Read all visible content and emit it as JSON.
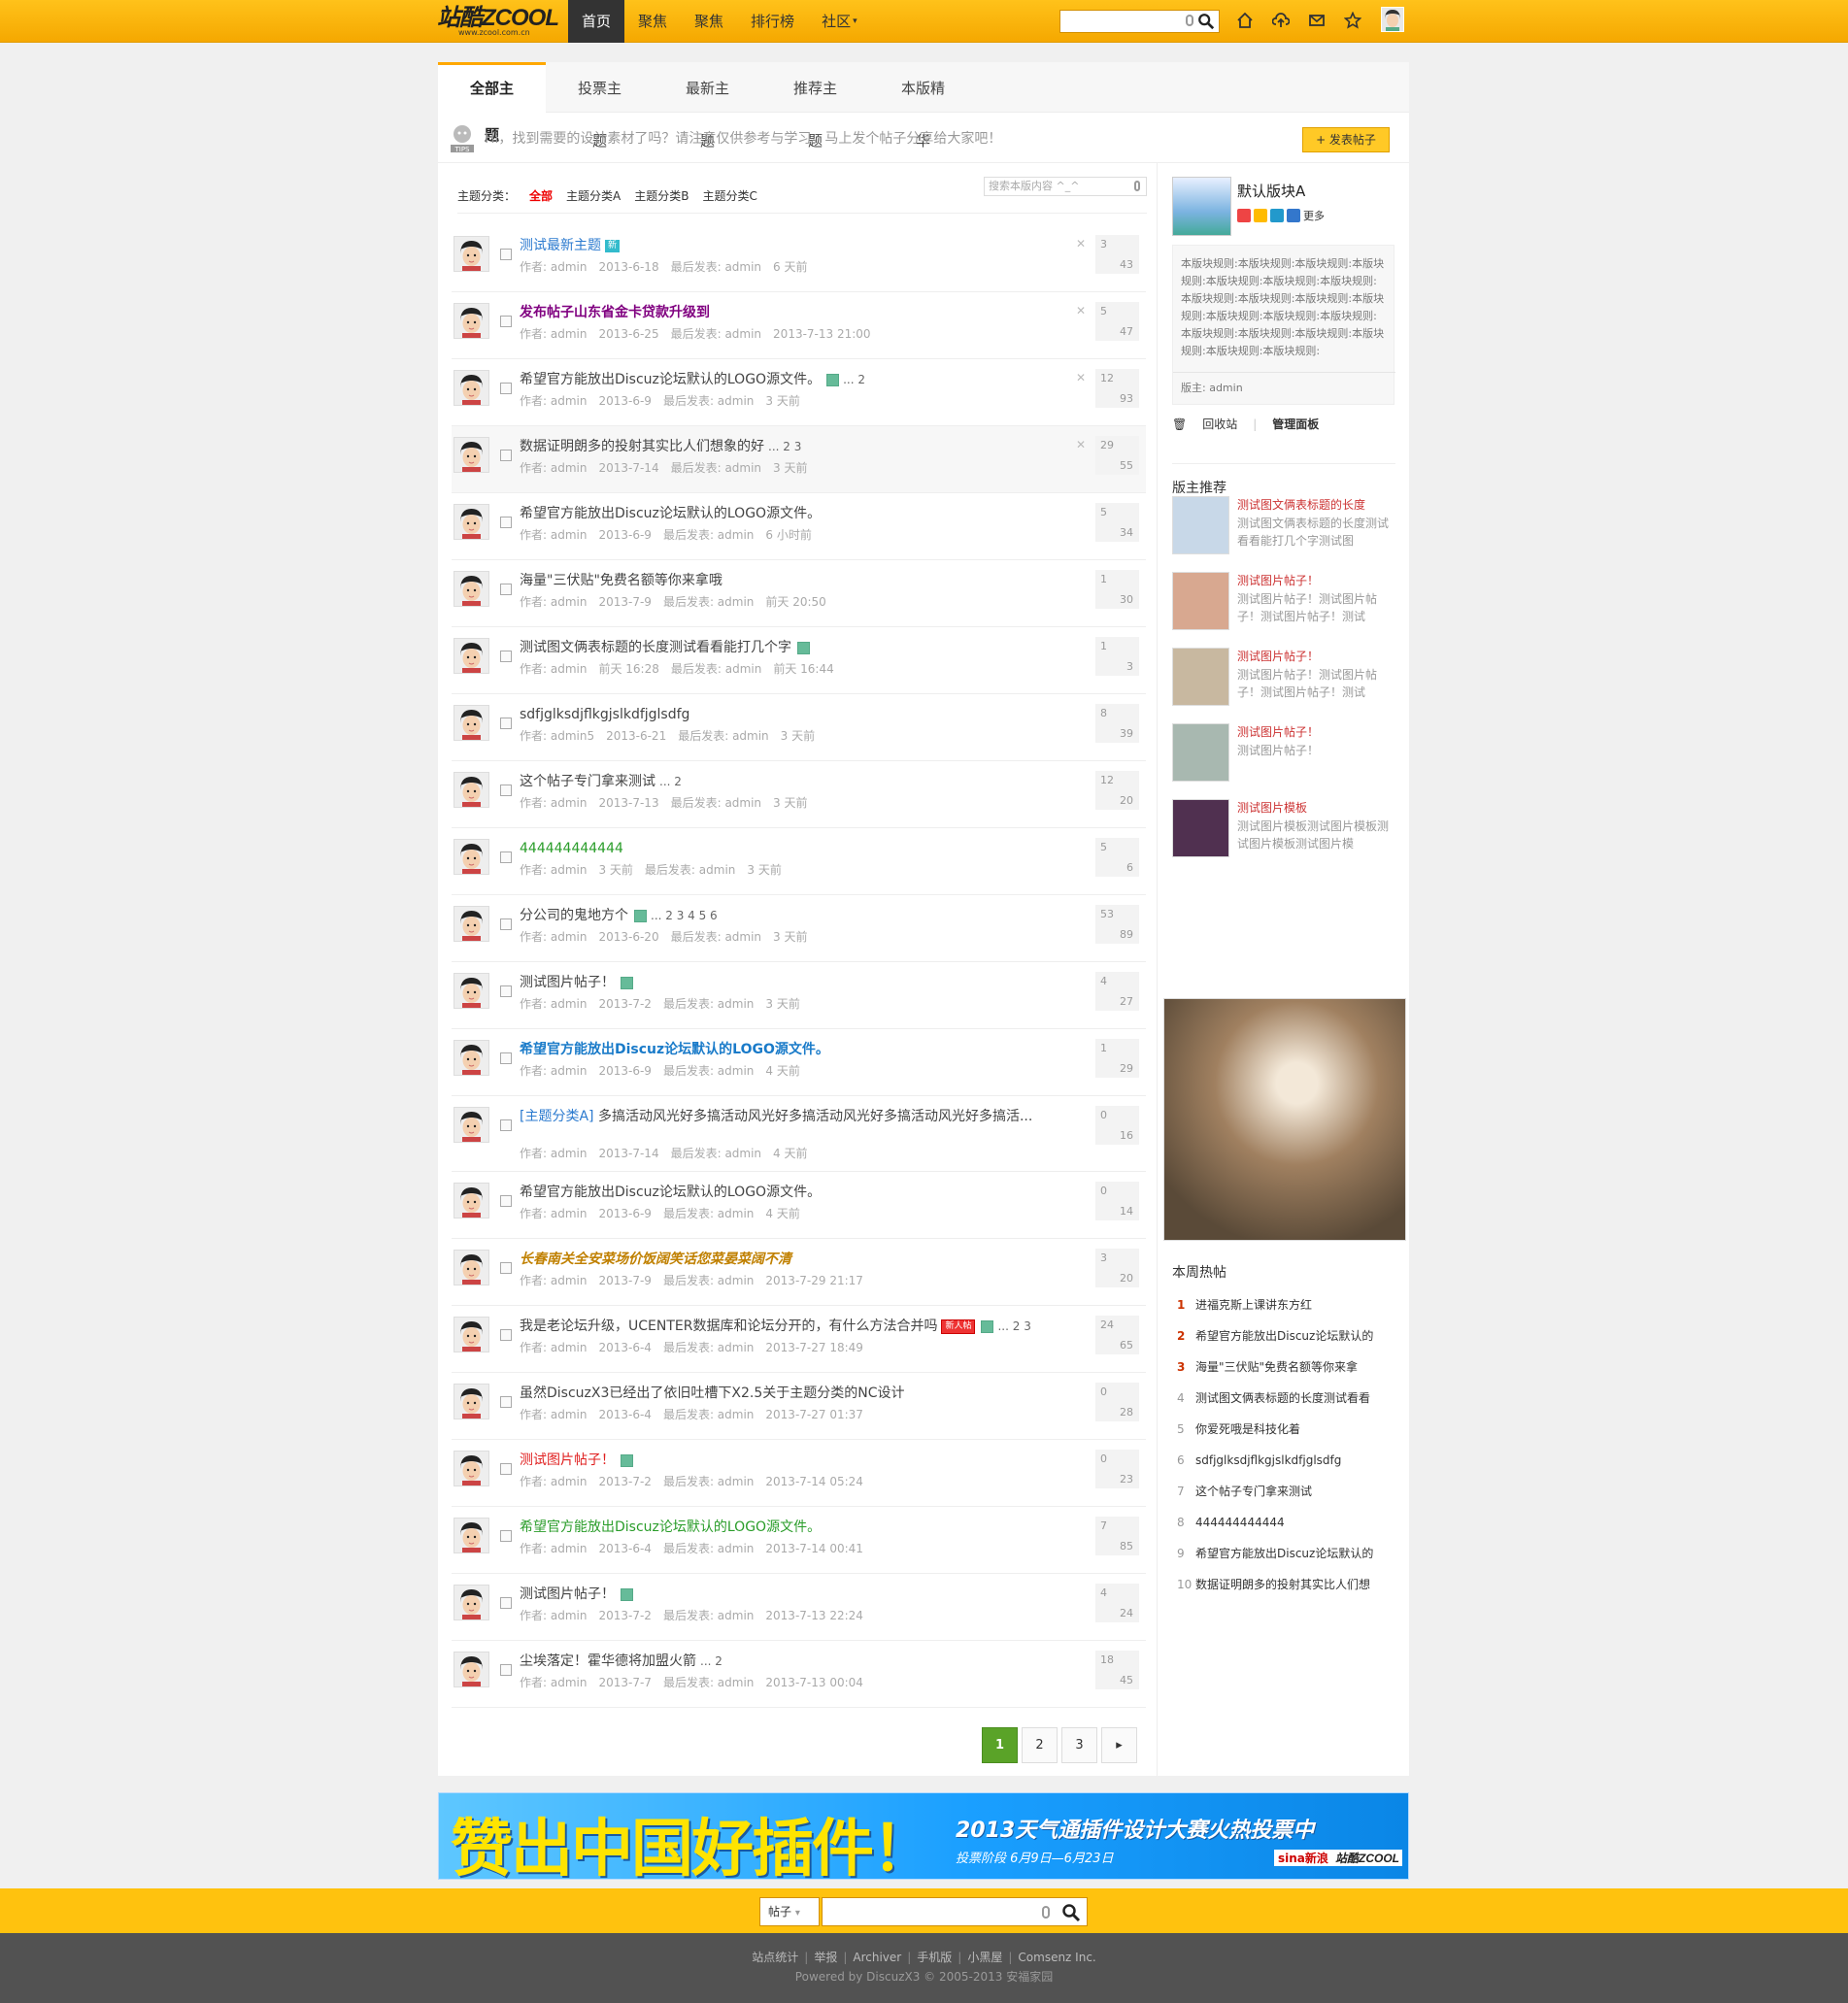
{
  "header": {
    "logo_text": "站酷ZCOOL",
    "logo_sub": "www.zcool.com.cn",
    "nav": [
      {
        "label": "首页",
        "active": true
      },
      {
        "label": "聚焦"
      },
      {
        "label": "聚焦"
      },
      {
        "label": "排行榜"
      },
      {
        "label": "社区"
      }
    ],
    "search_placeholder": "",
    "icons": [
      "home-icon",
      "upload-icon",
      "mail-icon",
      "star-icon"
    ]
  },
  "tabs": [
    {
      "label": "全部主题",
      "active": true
    },
    {
      "label": "投票主题"
    },
    {
      "label": "最新主题"
    },
    {
      "label": "推荐主题"
    },
    {
      "label": "本版精华"
    }
  ],
  "tips": {
    "text": "Hi，找到需要的设计素材了吗？请注意仅供参考与学习。马上发个帖子分享给大家吧！",
    "post_button": "+ 发表帖子"
  },
  "categories": {
    "label": "主题分类：",
    "items": [
      "全部",
      "主题分类A",
      "主题分类B",
      "主题分类C"
    ],
    "search_placeholder": "搜索本版内容 ^_^"
  },
  "threads": [
    {
      "title": "测试最新主题",
      "badge": "新",
      "color": "#2b7acf",
      "author": "admin",
      "date": "2013-6-18",
      "last": "admin",
      "last_time": "6 天前",
      "replies": "3",
      "views": "43",
      "x": true
    },
    {
      "title": "发布帖子山东省金卡贷款升级到",
      "color": "#800080",
      "bold": true,
      "author": "admin",
      "date": "2013-6-25",
      "last": "admin",
      "last_time": "2013-7-13 21:00",
      "replies": "5",
      "views": "47",
      "x": true
    },
    {
      "title": "希望官方能放出Discuz论坛默认的LOGO源文件。",
      "img": true,
      "pages": "... 2",
      "author": "admin",
      "date": "2013-6-9",
      "last": "admin",
      "last_time": "3 天前",
      "replies": "12",
      "views": "93",
      "x": true
    },
    {
      "title": "数据证明朗多的投射其实比人们想象的好",
      "pages": "... 2  3",
      "author": "admin",
      "date": "2013-7-14",
      "last": "admin",
      "last_time": "3 天前",
      "replies": "29",
      "views": "55",
      "x": true,
      "hl": true
    },
    {
      "title": "希望官方能放出Discuz论坛默认的LOGO源文件。",
      "author": "admin",
      "date": "2013-6-9",
      "last": "admin",
      "last_time": "6 小时前",
      "replies": "5",
      "views": "34"
    },
    {
      "title": "海量\"三伏贴\"免费名额等你来拿哦",
      "author": "admin",
      "date": "2013-7-9",
      "last": "admin",
      "last_time": "前天 20:50",
      "replies": "1",
      "views": "30"
    },
    {
      "title": "测试图文俩表标题的长度测试看看能打几个字",
      "img": true,
      "author": "admin",
      "date": "前天 16:28",
      "last": "admin",
      "last_time": "前天 16:44",
      "replies": "1",
      "views": "3"
    },
    {
      "title": "sdfjglksdjflkgjslkdfjglsdfg",
      "author": "admin5",
      "date": "2013-6-21",
      "last": "admin",
      "last_time": "3 天前",
      "replies": "8",
      "views": "39"
    },
    {
      "title": "这个帖子专门拿来测试",
      "pages": "... 2",
      "author": "admin",
      "date": "2013-7-13",
      "last": "admin",
      "last_time": "3 天前",
      "replies": "12",
      "views": "20"
    },
    {
      "title": "444444444444",
      "color": "#2a9d2a",
      "author": "admin",
      "date": "3 天前",
      "last": "admin",
      "last_time": "3 天前",
      "replies": "5",
      "views": "6"
    },
    {
      "title": "分公司的鬼地方个",
      "img": true,
      "pages": "... 2  3  4  5  6",
      "author": "admin",
      "date": "2013-6-20",
      "last": "admin",
      "last_time": "3 天前",
      "replies": "53",
      "views": "89"
    },
    {
      "title": "测试图片帖子！",
      "img": true,
      "author": "admin",
      "date": "2013-7-2",
      "last": "admin",
      "last_time": "3 天前",
      "replies": "4",
      "views": "27"
    },
    {
      "title": "希望官方能放出Discuz论坛默认的LOGO源文件。",
      "color": "#1a7bc9",
      "bold": true,
      "author": "admin",
      "date": "2013-6-9",
      "last": "admin",
      "last_time": "4 天前",
      "replies": "1",
      "views": "29"
    },
    {
      "prefix": "[主题分类A]",
      "title": "多搞活动风光好多搞活动风光好多搞活动风光好多搞活动风光好多搞活...",
      "tall": true,
      "author": "admin",
      "date": "2013-7-14",
      "last": "admin",
      "last_time": "4 天前",
      "replies": "0",
      "views": "16"
    },
    {
      "title": "希望官方能放出Discuz论坛默认的LOGO源文件。",
      "author": "admin",
      "date": "2013-6-9",
      "last": "admin",
      "last_time": "4 天前",
      "replies": "0",
      "views": "14"
    },
    {
      "title": "长春南关全安菜场价饭阔笑话您菜晏菜阔不清",
      "color": "#c08000",
      "italic": true,
      "bold": true,
      "author": "admin",
      "date": "2013-7-9",
      "last": "admin",
      "last_time": "2013-7-29 21:17",
      "replies": "3",
      "views": "20"
    },
    {
      "title": "我是老论坛升级，UCENTER数据库和论坛分开的，有什么方法合并吗",
      "badge": "新人帖",
      "img": true,
      "pages": "... 2  3",
      "author": "admin",
      "date": "2013-6-4",
      "last": "admin",
      "last_time": "2013-7-27 18:49",
      "replies": "24",
      "views": "65"
    },
    {
      "title": "虽然DiscuzX3已经出了依旧吐槽下X2.5关于主题分类的NC设计",
      "author": "admin",
      "date": "2013-6-4",
      "last": "admin",
      "last_time": "2013-7-27 01:37",
      "replies": "0",
      "views": "28"
    },
    {
      "title": "测试图片帖子！",
      "color": "#e02020",
      "img": true,
      "author": "admin",
      "date": "2013-7-2",
      "last": "admin",
      "last_time": "2013-7-14 05:24",
      "replies": "0",
      "views": "23"
    },
    {
      "title": "希望官方能放出Discuz论坛默认的LOGO源文件。",
      "color": "#2a9d2a",
      "author": "admin",
      "date": "2013-6-4",
      "last": "admin",
      "last_time": "2013-7-14 00:41",
      "replies": "7",
      "views": "85"
    },
    {
      "title": "测试图片帖子！",
      "img": true,
      "author": "admin",
      "date": "2013-7-2",
      "last": "admin",
      "last_time": "2013-7-13 22:24",
      "replies": "4",
      "views": "24"
    },
    {
      "title": "尘埃落定！霍华德将加盟火箭",
      "pages": "... 2",
      "author": "admin",
      "date": "2013-7-7",
      "last": "admin",
      "last_time": "2013-7-13 00:04",
      "replies": "18",
      "views": "45"
    }
  ],
  "meta_labels": {
    "author": "作者: ",
    "last": "最后发表: "
  },
  "pager": [
    "1",
    "2",
    "3",
    "▸"
  ],
  "side": {
    "forum_name": "默认版块A",
    "more": "更多",
    "rules": "本版块规则:本版块规则:本版块规则:本版块规则:本版块规则:本版块规则:本版块规则:本版块规则:本版块规则:本版块规则:本版块规则:本版块规则:本版块规则:本版块规则:本版块规则:本版块规则:本版块规则:本版块规则:本版块规则:本版块规则:",
    "moderator": "版主: admin",
    "recycle": "回收站",
    "manage": "管理面板",
    "rec_title": "版主推荐",
    "recs": [
      {
        "title": "测试图文俩表标题的长度",
        "desc": "测试图文俩表标题的长度测试看看能打几个字测试图",
        "bg": "#c8d8e8"
      },
      {
        "title": "测试图片帖子！",
        "desc": "测试图片帖子！测试图片帖子！测试图片帖子！测试",
        "bg": "#d8a890"
      },
      {
        "title": "测试图片帖子！",
        "desc": "测试图片帖子！测试图片帖子！测试图片帖子！测试",
        "bg": "#c8b8a0"
      },
      {
        "title": "测试图片帖子！",
        "desc": "测试图片帖子！",
        "bg": "#a8b8b0"
      },
      {
        "title": "测试图片模板",
        "desc": "测试图片模板测试图片模板测试图片模板测试图片模",
        "bg": "#503050"
      }
    ],
    "hot_title": "本周热帖",
    "hot": [
      "进福克斯上课讲东方红",
      "希望官方能放出Discuz论坛默认的",
      "海量\"三伏贴\"免费名额等你来拿",
      "测试图文俩表标题的长度测试看看",
      "你爱死哦是科技化着",
      "sdfjglksdjflkgjslkdfjglsdfg",
      "这个帖子专门拿来测试",
      "444444444444",
      "希望官方能放出Discuz论坛默认的",
      "数据证明朗多的投射其实比人们想"
    ]
  },
  "banner": {
    "main": "赞出中国好插件！",
    "title": "2013天气通插件设计大赛火热投票中",
    "sub": "投票阶段  6月9日—6月23日",
    "sina": "sina新浪",
    "zcool": "站酷ZCOOL"
  },
  "footer": {
    "select": "帖子",
    "links": [
      "站点统计",
      "举报",
      "Archiver",
      "手机版",
      "小黑屋",
      "Comsenz Inc."
    ],
    "powered": "Powered by DiscuzX3 © 2005-2013 安福家园"
  }
}
